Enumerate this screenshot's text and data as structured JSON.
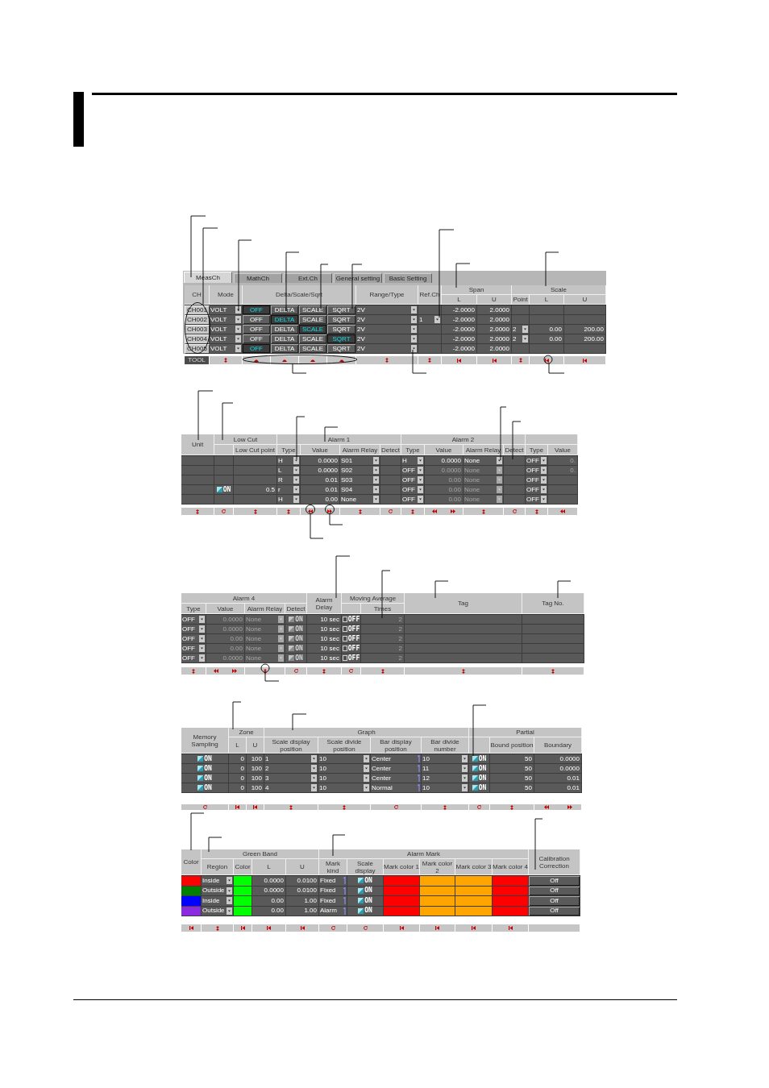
{
  "tables": [
    {
      "tabs": [
        {
          "label": "MeasCh",
          "selected": true
        },
        {
          "label": "MathCh",
          "selected": false
        },
        {
          "label": "Ext.Ch",
          "selected": false
        },
        {
          "label": "General setting",
          "selected": false
        },
        {
          "label": "Basic Setting",
          "selected": false
        }
      ],
      "header": [
        {
          "label": "CH"
        },
        {
          "label": "Mode"
        },
        {
          "label": "Delta/Scale/Sqrt"
        },
        {
          "label": "Range/Type"
        },
        {
          "label": "Ref.Ch"
        },
        {
          "label": "Span",
          "columns": [
            {
              "label": "L"
            },
            {
              "label": "U"
            }
          ]
        },
        {
          "label": "Scale",
          "columns": [
            {
              "label": "Point"
            },
            {
              "label": "L"
            },
            {
              "label": "U"
            }
          ]
        }
      ],
      "rows": [
        [
          {
            "kind": "channel",
            "text": "CH001"
          },
          {
            "kind": "dropdown",
            "value": "VOLT"
          },
          {
            "kind": "toggle",
            "label": "OFF",
            "selected": true
          },
          {
            "kind": "toggle",
            "label": "DELTA",
            "selected": false
          },
          {
            "kind": "toggle",
            "label": "SCALE",
            "selected": false
          },
          {
            "kind": "toggle",
            "label": "SQRT",
            "selected": false
          },
          {
            "kind": "dropdown",
            "value": "2V"
          },
          {
            "kind": "empty"
          },
          {
            "kind": "text",
            "value": "-2.0000"
          },
          {
            "kind": "text",
            "value": "2.0000"
          },
          {
            "kind": "empty"
          },
          {
            "kind": "empty"
          },
          {
            "kind": "empty"
          }
        ],
        [
          {
            "kind": "channel",
            "text": "CH002"
          },
          {
            "kind": "dropdown",
            "value": "VOLT"
          },
          {
            "kind": "toggle",
            "label": "OFF",
            "selected": false
          },
          {
            "kind": "toggle",
            "label": "DELTA",
            "selected": true
          },
          {
            "kind": "toggle",
            "label": "SCALE",
            "selected": false
          },
          {
            "kind": "toggle",
            "label": "SQRT",
            "selected": false
          },
          {
            "kind": "dropdown",
            "value": "2V"
          },
          {
            "kind": "dropdown",
            "value": "1"
          },
          {
            "kind": "text",
            "value": "-2.0000"
          },
          {
            "kind": "text",
            "value": "2.0000"
          },
          {
            "kind": "empty"
          },
          {
            "kind": "empty"
          },
          {
            "kind": "empty"
          }
        ],
        [
          {
            "kind": "channel",
            "text": "CH003"
          },
          {
            "kind": "dropdown",
            "value": "VOLT"
          },
          {
            "kind": "toggle",
            "label": "OFF",
            "selected": false
          },
          {
            "kind": "toggle",
            "label": "DELTA",
            "selected": false
          },
          {
            "kind": "toggle",
            "label": "SCALE",
            "selected": true
          },
          {
            "kind": "toggle",
            "label": "SQRT",
            "selected": false
          },
          {
            "kind": "dropdown",
            "value": "2V"
          },
          {
            "kind": "empty"
          },
          {
            "kind": "text",
            "value": "-2.0000"
          },
          {
            "kind": "text",
            "value": "2.0000"
          },
          {
            "kind": "dropdown",
            "value": "2"
          },
          {
            "kind": "text",
            "value": "0.00"
          },
          {
            "kind": "text",
            "value": "200.00"
          }
        ],
        [
          {
            "kind": "channel",
            "text": "CH004"
          },
          {
            "kind": "dropdown",
            "value": "VOLT"
          },
          {
            "kind": "toggle",
            "label": "OFF",
            "selected": false
          },
          {
            "kind": "toggle",
            "label": "DELTA",
            "selected": false
          },
          {
            "kind": "toggle",
            "label": "SCALE",
            "selected": false
          },
          {
            "kind": "toggle",
            "label": "SQRT",
            "selected": true
          },
          {
            "kind": "dropdown",
            "value": "2V"
          },
          {
            "kind": "empty"
          },
          {
            "kind": "text",
            "value": "-2.0000"
          },
          {
            "kind": "text",
            "value": "2.0000"
          },
          {
            "kind": "dropdown",
            "value": "2"
          },
          {
            "kind": "text",
            "value": "0.00"
          },
          {
            "kind": "text",
            "value": "200.00"
          }
        ],
        [
          {
            "kind": "channel",
            "text": "CH005"
          },
          {
            "kind": "dropdown",
            "value": "VOLT"
          },
          {
            "kind": "toggle",
            "label": "OFF",
            "selected": true
          },
          {
            "kind": "toggle",
            "label": "DELTA",
            "selected": false
          },
          {
            "kind": "toggle",
            "label": "SCALE",
            "selected": false
          },
          {
            "kind": "toggle",
            "label": "SQRT",
            "selected": false
          },
          {
            "kind": "dropdown",
            "value": "2V"
          },
          {
            "kind": "empty"
          },
          {
            "kind": "text",
            "value": "-2.0000"
          },
          {
            "kind": "text",
            "value": "2.0000"
          },
          {
            "kind": "empty"
          },
          {
            "kind": "empty"
          },
          {
            "kind": "empty"
          }
        ]
      ],
      "footer_label": "TOOL"
    },
    {
      "header": [
        {
          "label": "Unit"
        },
        {
          "label": "Low Cut",
          "columns": [
            {},
            {
              "label": "Low Cut point"
            }
          ]
        },
        {
          "label": "Alarm 1",
          "columns": [
            {
              "label": "Type"
            },
            {
              "label": "Value"
            },
            {
              "label": "Alarm Relay"
            },
            {
              "label": "Detect"
            }
          ]
        },
        {
          "label": "Alarm 2",
          "columns": [
            {
              "label": "Type"
            },
            {
              "label": "Value"
            },
            {
              "label": "Alarm Relay"
            },
            {
              "label": "Detect"
            }
          ]
        },
        {
          "columns": [
            {
              "label": "Type"
            },
            {
              "label": "Value"
            }
          ]
        }
      ],
      "rows": [
        [
          {
            "kind": "empty"
          },
          {
            "kind": "empty"
          },
          {
            "kind": "empty"
          },
          {
            "kind": "dropdown",
            "value": "H",
            "disabled": false
          },
          {
            "kind": "text",
            "value": "0.0000",
            "disabled": false
          },
          {
            "kind": "dropdown",
            "value": "S01",
            "disabled": false
          },
          {
            "kind": "empty"
          },
          {
            "kind": "dropdown",
            "value": "H",
            "disabled": false
          },
          {
            "kind": "text",
            "value": "0.0000",
            "disabled": false
          },
          {
            "kind": "dropdown",
            "value": "None",
            "disabled": false
          },
          {
            "kind": "empty"
          },
          {
            "kind": "dropdown",
            "value": "OFF",
            "disabled": false
          },
          {
            "kind": "text",
            "value": "0.",
            "disabled": true
          }
        ],
        [
          {
            "kind": "empty"
          },
          {
            "kind": "empty"
          },
          {
            "kind": "empty"
          },
          {
            "kind": "dropdown",
            "value": "L",
            "disabled": false
          },
          {
            "kind": "text",
            "value": "0.0000",
            "disabled": false
          },
          {
            "kind": "dropdown",
            "value": "S02",
            "disabled": false
          },
          {
            "kind": "empty"
          },
          {
            "kind": "dropdown",
            "value": "OFF",
            "disabled": false
          },
          {
            "kind": "text",
            "value": "0.0000",
            "disabled": true
          },
          {
            "kind": "dropdown",
            "value": "None",
            "disabled": true
          },
          {
            "kind": "empty"
          },
          {
            "kind": "dropdown",
            "value": "OFF",
            "disabled": false
          },
          {
            "kind": "text",
            "value": "0.",
            "disabled": true
          }
        ],
        [
          {
            "kind": "empty"
          },
          {
            "kind": "empty"
          },
          {
            "kind": "empty"
          },
          {
            "kind": "dropdown",
            "value": "R",
            "disabled": false
          },
          {
            "kind": "text",
            "value": "0.01",
            "disabled": false
          },
          {
            "kind": "dropdown",
            "value": "S03",
            "disabled": false
          },
          {
            "kind": "empty"
          },
          {
            "kind": "dropdown",
            "value": "OFF",
            "disabled": false
          },
          {
            "kind": "text",
            "value": "0.00",
            "disabled": true
          },
          {
            "kind": "dropdown",
            "value": "None",
            "disabled": true
          },
          {
            "kind": "empty"
          },
          {
            "kind": "dropdown",
            "value": "OFF",
            "disabled": false
          },
          {
            "kind": "empty"
          }
        ],
        [
          {
            "kind": "empty"
          },
          {
            "kind": "checkbox",
            "label": "ON",
            "checked": true
          },
          {
            "kind": "text",
            "value": "0.5",
            "disabled": false
          },
          {
            "kind": "dropdown",
            "value": "r",
            "disabled": false
          },
          {
            "kind": "text",
            "value": "0.01",
            "disabled": false
          },
          {
            "kind": "dropdown",
            "value": "S04",
            "disabled": false
          },
          {
            "kind": "empty"
          },
          {
            "kind": "dropdown",
            "value": "OFF",
            "disabled": false
          },
          {
            "kind": "text",
            "value": "0.00",
            "disabled": true
          },
          {
            "kind": "dropdown",
            "value": "None",
            "disabled": true
          },
          {
            "kind": "empty"
          },
          {
            "kind": "dropdown",
            "value": "OFF",
            "disabled": false
          },
          {
            "kind": "empty"
          }
        ],
        [
          {
            "kind": "empty"
          },
          {
            "kind": "empty"
          },
          {
            "kind": "empty"
          },
          {
            "kind": "dropdown",
            "value": "H",
            "disabled": false
          },
          {
            "kind": "text",
            "value": "0.00",
            "disabled": false
          },
          {
            "kind": "dropdown",
            "value": "None",
            "disabled": false
          },
          {
            "kind": "empty"
          },
          {
            "kind": "dropdown",
            "value": "OFF",
            "disabled": false
          },
          {
            "kind": "text",
            "value": "0.00",
            "disabled": true
          },
          {
            "kind": "dropdown",
            "value": "None",
            "disabled": true
          },
          {
            "kind": "empty"
          },
          {
            "kind": "dropdown",
            "value": "OFF",
            "disabled": false
          },
          {
            "kind": "empty"
          }
        ]
      ]
    },
    {
      "header": [
        {
          "label": "Alarm 4",
          "columns": [
            {
              "label": "Type"
            },
            {
              "label": "Value"
            },
            {
              "label": "Alarm Relay"
            },
            {
              "label": "Detect"
            }
          ]
        },
        {
          "label": "Alarm Delay"
        },
        {
          "label": "Moving Average",
          "columns": [
            {},
            {
              "label": "Times"
            }
          ]
        },
        {
          "label": "Tag"
        },
        {
          "label": "Tag No."
        }
      ],
      "rows": [
        [
          {
            "kind": "dropdown",
            "value": "OFF",
            "disabled": false
          },
          {
            "kind": "text",
            "value": "0.0000",
            "disabled": true
          },
          {
            "kind": "dropdown",
            "value": "None",
            "disabled": true
          },
          {
            "kind": "checkbox",
            "label": "ON",
            "checked": true,
            "disabled": true
          },
          {
            "kind": "text",
            "value": "10 sec",
            "disabled": false
          },
          {
            "kind": "checkbox",
            "label": "OFF",
            "checked": false,
            "disabled": false
          },
          {
            "kind": "text",
            "value": "2",
            "disabled": true
          },
          {
            "kind": "empty"
          },
          {
            "kind": "empty"
          }
        ],
        [
          {
            "kind": "dropdown",
            "value": "OFF",
            "disabled": false
          },
          {
            "kind": "text",
            "value": "0.0000",
            "disabled": true
          },
          {
            "kind": "dropdown",
            "value": "None",
            "disabled": true
          },
          {
            "kind": "checkbox",
            "label": "ON",
            "checked": true,
            "disabled": true
          },
          {
            "kind": "text",
            "value": "10 sec",
            "disabled": false
          },
          {
            "kind": "checkbox",
            "label": "OFF",
            "checked": false,
            "disabled": false
          },
          {
            "kind": "text",
            "value": "2",
            "disabled": true
          },
          {
            "kind": "empty"
          },
          {
            "kind": "empty"
          }
        ],
        [
          {
            "kind": "dropdown",
            "value": "OFF",
            "disabled": false
          },
          {
            "kind": "text",
            "value": "0.00",
            "disabled": true
          },
          {
            "kind": "dropdown",
            "value": "None",
            "disabled": true
          },
          {
            "kind": "checkbox",
            "label": "ON",
            "checked": true,
            "disabled": true
          },
          {
            "kind": "text",
            "value": "10 sec",
            "disabled": false
          },
          {
            "kind": "checkbox",
            "label": "OFF",
            "checked": false,
            "disabled": false
          },
          {
            "kind": "text",
            "value": "2",
            "disabled": true
          },
          {
            "kind": "empty"
          },
          {
            "kind": "empty"
          }
        ],
        [
          {
            "kind": "dropdown",
            "value": "OFF",
            "disabled": false
          },
          {
            "kind": "text",
            "value": "0.00",
            "disabled": true
          },
          {
            "kind": "dropdown",
            "value": "None",
            "disabled": true
          },
          {
            "kind": "checkbox",
            "label": "ON",
            "checked": true,
            "disabled": true
          },
          {
            "kind": "text",
            "value": "10 sec",
            "disabled": false
          },
          {
            "kind": "checkbox",
            "label": "OFF",
            "checked": false,
            "disabled": false
          },
          {
            "kind": "text",
            "value": "2",
            "disabled": true
          },
          {
            "kind": "empty"
          },
          {
            "kind": "empty"
          }
        ],
        [
          {
            "kind": "dropdown",
            "value": "OFF",
            "disabled": false
          },
          {
            "kind": "text",
            "value": "0.0000",
            "disabled": true
          },
          {
            "kind": "dropdown",
            "value": "None",
            "disabled": true
          },
          {
            "kind": "checkbox",
            "label": "ON",
            "checked": true,
            "disabled": true
          },
          {
            "kind": "text",
            "value": "10 sec",
            "disabled": false
          },
          {
            "kind": "checkbox",
            "label": "OFF",
            "checked": false,
            "disabled": false
          },
          {
            "kind": "text",
            "value": "2",
            "disabled": true
          },
          {
            "kind": "empty"
          },
          {
            "kind": "empty"
          }
        ]
      ]
    },
    {
      "header": [
        {
          "label": "Memory Sampling"
        },
        {
          "label": "Zone",
          "columns": [
            {
              "label": "L"
            },
            {
              "label": "U"
            }
          ]
        },
        {
          "label": "Graph",
          "columns": [
            {
              "label": "Scale display position"
            },
            {
              "label": "Scale divide position"
            },
            {
              "label": "Bar display position"
            },
            {
              "label": "Bar divide number"
            }
          ]
        },
        {
          "label": "Partial",
          "columns": [
            {},
            {
              "label": "Bound position"
            },
            {
              "label": "Boundary"
            }
          ]
        }
      ],
      "rows": [
        [
          {
            "kind": "checkbox",
            "label": "ON",
            "checked": true
          },
          {
            "kind": "text",
            "value": "0"
          },
          {
            "kind": "text",
            "value": "100"
          },
          {
            "kind": "dropdown",
            "value": "1"
          },
          {
            "kind": "dropdown",
            "value": "10"
          },
          {
            "kind": "spinner",
            "value": "Center"
          },
          {
            "kind": "dropdown",
            "value": "10"
          },
          {
            "kind": "checkbox",
            "label": "ON",
            "checked": true
          },
          {
            "kind": "text",
            "value": "50"
          },
          {
            "kind": "text",
            "value": "0.0000"
          }
        ],
        [
          {
            "kind": "checkbox",
            "label": "ON",
            "checked": true
          },
          {
            "kind": "text",
            "value": "0"
          },
          {
            "kind": "text",
            "value": "100"
          },
          {
            "kind": "dropdown",
            "value": "2"
          },
          {
            "kind": "dropdown",
            "value": "10"
          },
          {
            "kind": "spinner",
            "value": "Center"
          },
          {
            "kind": "dropdown",
            "value": "11"
          },
          {
            "kind": "checkbox",
            "label": "ON",
            "checked": true
          },
          {
            "kind": "text",
            "value": "50"
          },
          {
            "kind": "text",
            "value": "0.0000"
          }
        ],
        [
          {
            "kind": "checkbox",
            "label": "ON",
            "checked": true
          },
          {
            "kind": "text",
            "value": "0"
          },
          {
            "kind": "text",
            "value": "100"
          },
          {
            "kind": "dropdown",
            "value": "3"
          },
          {
            "kind": "dropdown",
            "value": "10"
          },
          {
            "kind": "spinner",
            "value": "Center"
          },
          {
            "kind": "dropdown",
            "value": "12"
          },
          {
            "kind": "checkbox",
            "label": "ON",
            "checked": true
          },
          {
            "kind": "text",
            "value": "50"
          },
          {
            "kind": "text",
            "value": "0.01"
          }
        ],
        [
          {
            "kind": "checkbox",
            "label": "ON",
            "checked": true
          },
          {
            "kind": "text",
            "value": "0"
          },
          {
            "kind": "text",
            "value": "100"
          },
          {
            "kind": "dropdown",
            "value": "4"
          },
          {
            "kind": "dropdown",
            "value": "10"
          },
          {
            "kind": "spinner",
            "value": "Normal"
          },
          {
            "kind": "dropdown",
            "value": "10"
          },
          {
            "kind": "checkbox",
            "label": "ON",
            "checked": true
          },
          {
            "kind": "text",
            "value": "50"
          },
          {
            "kind": "text",
            "value": "0.01"
          }
        ]
      ]
    },
    {
      "header": [
        {
          "label": "Color"
        },
        {
          "label": "Green Band",
          "columns": [
            {
              "label": "Region"
            },
            {
              "label": "Color"
            },
            {
              "label": "L"
            },
            {
              "label": "U"
            }
          ]
        },
        {
          "label": "Alarm Mark",
          "columns": [
            {
              "label": "Mark kind"
            },
            {
              "label": "Scale display"
            },
            {
              "label": "Mark color 1"
            },
            {
              "label": "Mark color 2"
            },
            {
              "label": "Mark color 3"
            },
            {
              "label": "Mark color 4"
            }
          ]
        },
        {
          "label": "Calibration Correction"
        }
      ],
      "rows": [
        [
          {
            "kind": "swatch",
            "color": "#ff0000"
          },
          {
            "kind": "dropdown",
            "value": "Inside"
          },
          {
            "kind": "swatch",
            "color": "#00ff00"
          },
          {
            "kind": "text",
            "value": "0.0000"
          },
          {
            "kind": "text",
            "value": "0.0100"
          },
          {
            "kind": "spinner",
            "value": "Fixed"
          },
          {
            "kind": "checkbox",
            "label": "ON",
            "checked": true
          },
          {
            "kind": "swatch",
            "color": "#ff0000"
          },
          {
            "kind": "swatch",
            "color": "#ffa500"
          },
          {
            "kind": "swatch",
            "color": "#ffa500"
          },
          {
            "kind": "swatch",
            "color": "#ff0000"
          },
          {
            "kind": "button",
            "label": "Off"
          }
        ],
        [
          {
            "kind": "swatch",
            "color": "#008000"
          },
          {
            "kind": "dropdown",
            "value": "Outside"
          },
          {
            "kind": "swatch",
            "color": "#00ff00"
          },
          {
            "kind": "text",
            "value": "0.0000"
          },
          {
            "kind": "text",
            "value": "0.0100"
          },
          {
            "kind": "spinner",
            "value": "Fixed"
          },
          {
            "kind": "checkbox",
            "label": "ON",
            "checked": true
          },
          {
            "kind": "swatch",
            "color": "#ff0000"
          },
          {
            "kind": "swatch",
            "color": "#ffa500"
          },
          {
            "kind": "swatch",
            "color": "#ffa500"
          },
          {
            "kind": "swatch",
            "color": "#ff0000"
          },
          {
            "kind": "button",
            "label": "Off"
          }
        ],
        [
          {
            "kind": "swatch",
            "color": "#0000ff"
          },
          {
            "kind": "dropdown",
            "value": "Inside"
          },
          {
            "kind": "swatch",
            "color": "#00ff00"
          },
          {
            "kind": "text",
            "value": "0.00"
          },
          {
            "kind": "text",
            "value": "1.00"
          },
          {
            "kind": "spinner",
            "value": "Fixed"
          },
          {
            "kind": "checkbox",
            "label": "ON",
            "checked": true
          },
          {
            "kind": "swatch",
            "color": "#ff0000"
          },
          {
            "kind": "swatch",
            "color": "#ffa500"
          },
          {
            "kind": "swatch",
            "color": "#ffa500"
          },
          {
            "kind": "swatch",
            "color": "#ff0000"
          },
          {
            "kind": "button",
            "label": "Off"
          }
        ],
        [
          {
            "kind": "swatch",
            "color": "#8a2be2"
          },
          {
            "kind": "dropdown",
            "value": "Outside"
          },
          {
            "kind": "swatch",
            "color": "#00ff00"
          },
          {
            "kind": "text",
            "value": "0.00"
          },
          {
            "kind": "text",
            "value": "1.00"
          },
          {
            "kind": "spinner",
            "value": "Alarm"
          },
          {
            "kind": "checkbox",
            "label": "ON",
            "checked": true
          },
          {
            "kind": "swatch",
            "color": "#ff0000"
          },
          {
            "kind": "swatch",
            "color": "#ffa500"
          },
          {
            "kind": "swatch",
            "color": "#ffa500"
          },
          {
            "kind": "swatch",
            "color": "#ff0000"
          },
          {
            "kind": "button",
            "label": "Off"
          }
        ]
      ]
    }
  ]
}
